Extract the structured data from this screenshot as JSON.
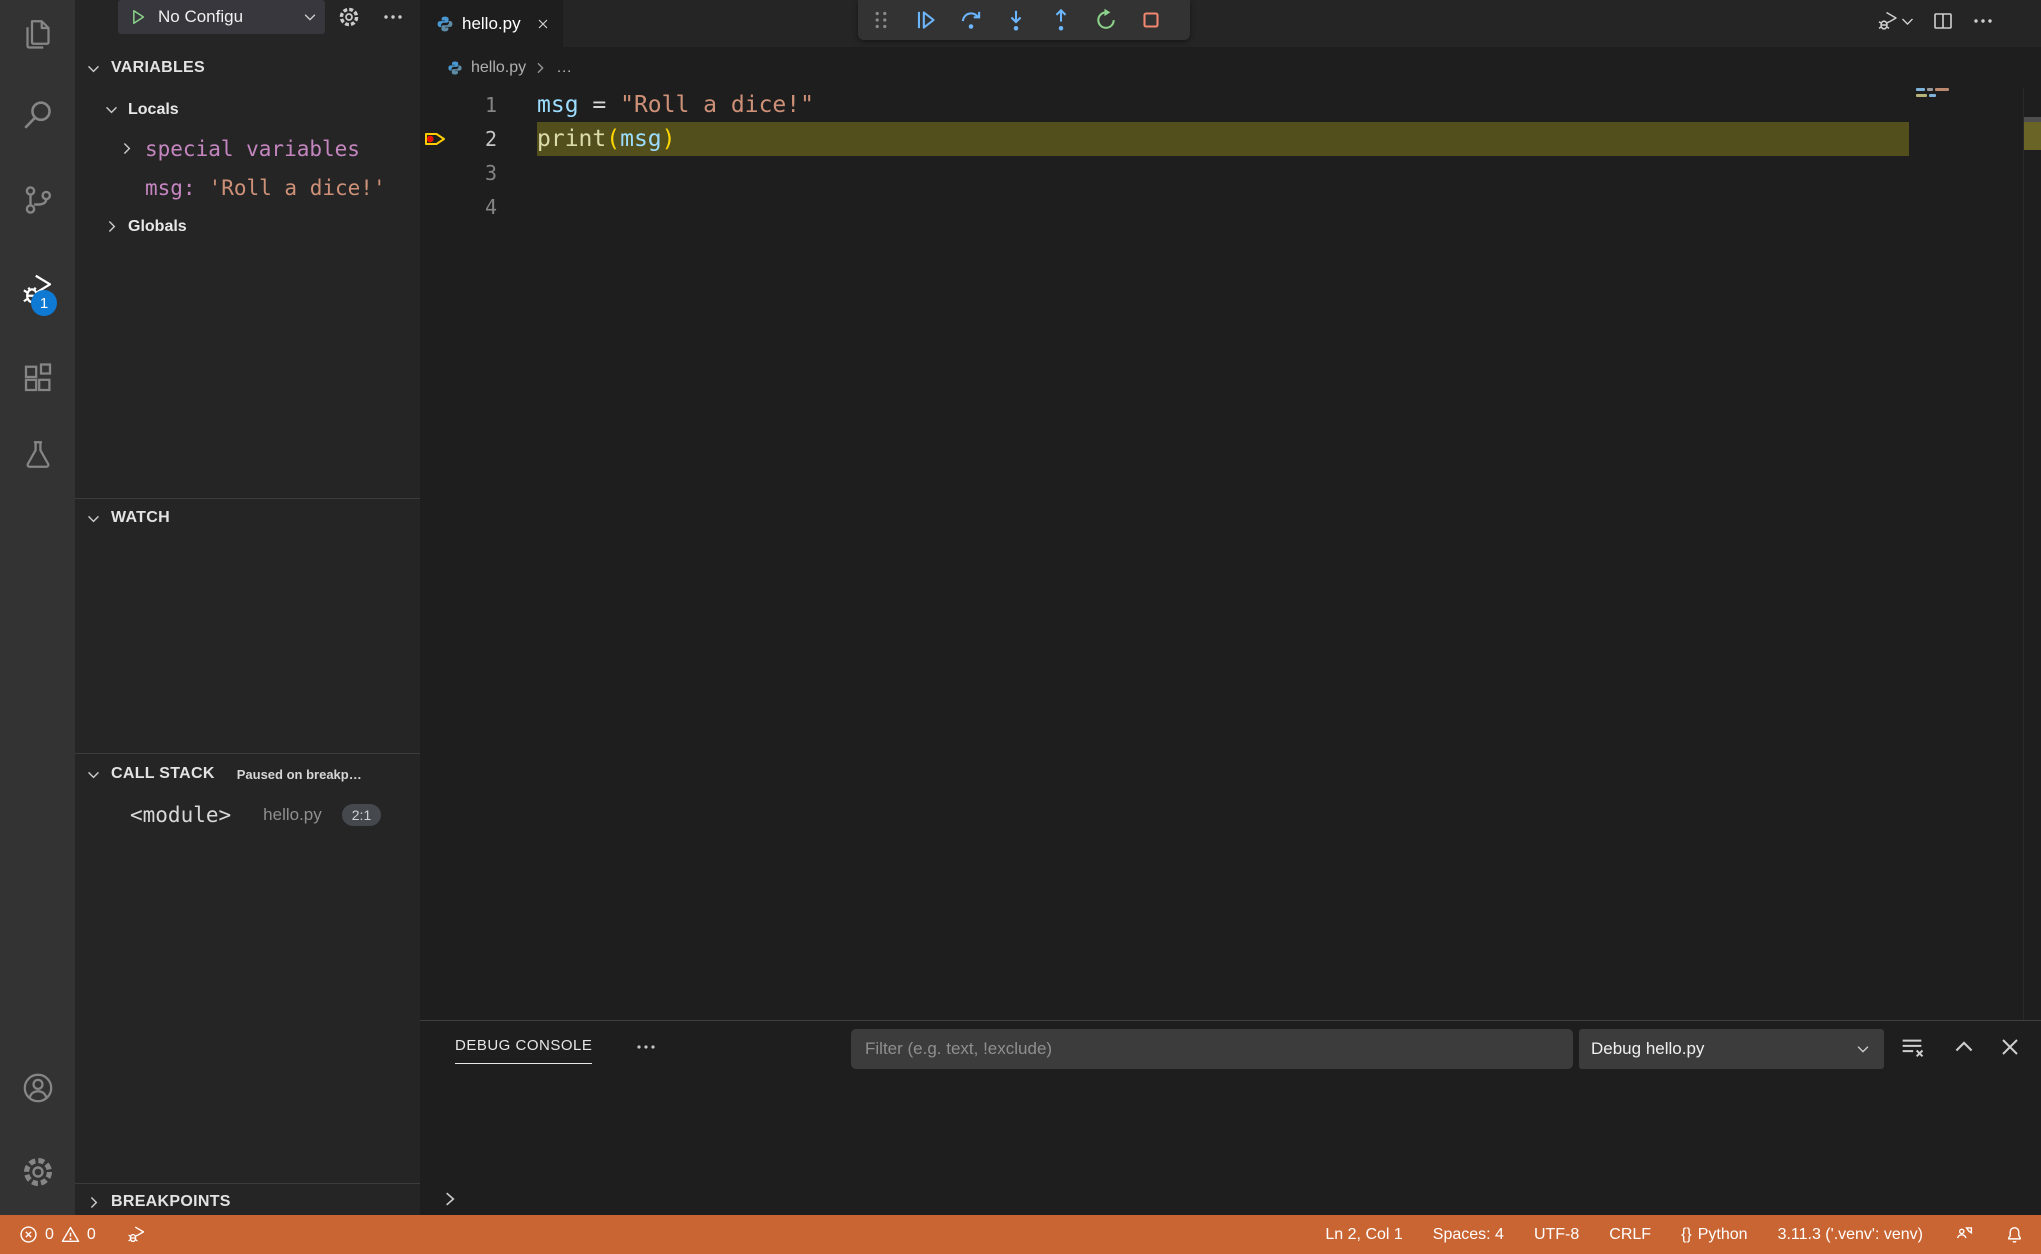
{
  "colors": {
    "status_bar_debugging": "#c96533",
    "activity_badge": "#0e7ad3",
    "debug_blue": "#6cb6ff",
    "restart_green": "#8bd28b",
    "stop_red": "#f48771",
    "breakpoint_red": "#e51400",
    "breakpoint_arrow_yellow": "#ffcc00",
    "current_line_highlight": "#524f1c"
  },
  "debug_header": {
    "config_label": "No Configu"
  },
  "sidebar": {
    "variables": {
      "title": "VARIABLES",
      "locals": "Locals",
      "special": "special variables",
      "msg_name": "msg:",
      "msg_value": "'Roll a dice!'",
      "globals": "Globals"
    },
    "watch": {
      "title": "WATCH"
    },
    "call_stack": {
      "title": "CALL STACK",
      "status": "Paused on breakp…",
      "frame_name": "<module>",
      "frame_file": "hello.py",
      "frame_pos": "2:1"
    },
    "breakpoints": {
      "title": "BREAKPOINTS"
    }
  },
  "editor": {
    "tab_label": "hello.py",
    "breadcrumb_file": "hello.py",
    "breadcrumb_symbol": "…",
    "lines": [
      {
        "num": "1",
        "t0": "msg",
        "t1": " = ",
        "t2": "\"Roll a dice!\""
      },
      {
        "num": "2",
        "t0": "print",
        "t1": "(",
        "t2": "msg",
        "t3": ")"
      },
      {
        "num": "3"
      },
      {
        "num": "4"
      }
    ]
  },
  "panel": {
    "tab": "DEBUG CONSOLE",
    "filter_placeholder": "Filter (e.g. text, !exclude)",
    "session": "Debug hello.py"
  },
  "status_bar": {
    "errors": "0",
    "warnings": "0",
    "line_col": "Ln 2, Col 1",
    "spaces": "Spaces: 4",
    "encoding": "UTF-8",
    "eol": "CRLF",
    "language_icon": "{}",
    "language": "Python",
    "interpreter": "3.11.3 ('.venv': venv)"
  }
}
